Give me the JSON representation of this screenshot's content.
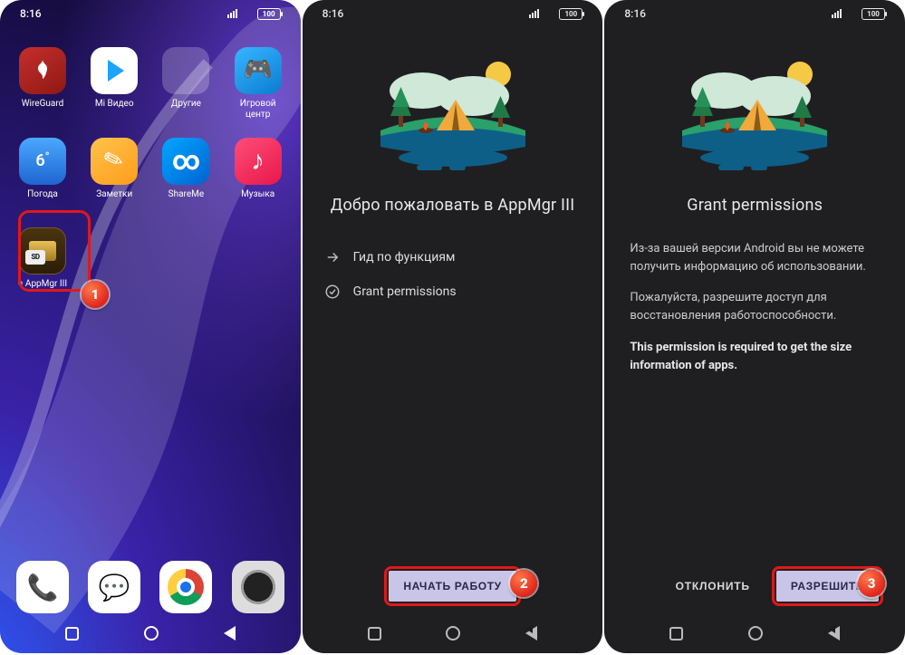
{
  "status": {
    "time": "8:16",
    "battery": "100"
  },
  "home": {
    "apps": {
      "wireguard": "WireGuard",
      "mivideo": "Mi Видео",
      "other": "Другие",
      "gamecenter": "Игровой центр",
      "weather_temp": "6",
      "weather": "Погода",
      "notes": "Заметки",
      "shareme": "ShareMe",
      "music": "Музыка",
      "appmgr": "AppMgr III",
      "sd": "SD"
    }
  },
  "screen2": {
    "title": "Добро пожаловать в AppMgr III",
    "item1": "Гид по функциям",
    "item2": "Grant permissions",
    "cta": "НАЧАТЬ РАБОТУ"
  },
  "screen3": {
    "title": "Grant permissions",
    "p1": "Из-за вашей версии Android вы не можете получить информацию об использовании.",
    "p2": "Пожалуйста, разрешите доступ для восстановления работоспособности.",
    "p3": "This permission is required to get the size information of apps.",
    "decline": "ОТКЛОНИТЬ",
    "allow": "РАЗРЕШИТЬ"
  },
  "badges": {
    "b1": "1",
    "b2": "2",
    "b3": "3"
  }
}
